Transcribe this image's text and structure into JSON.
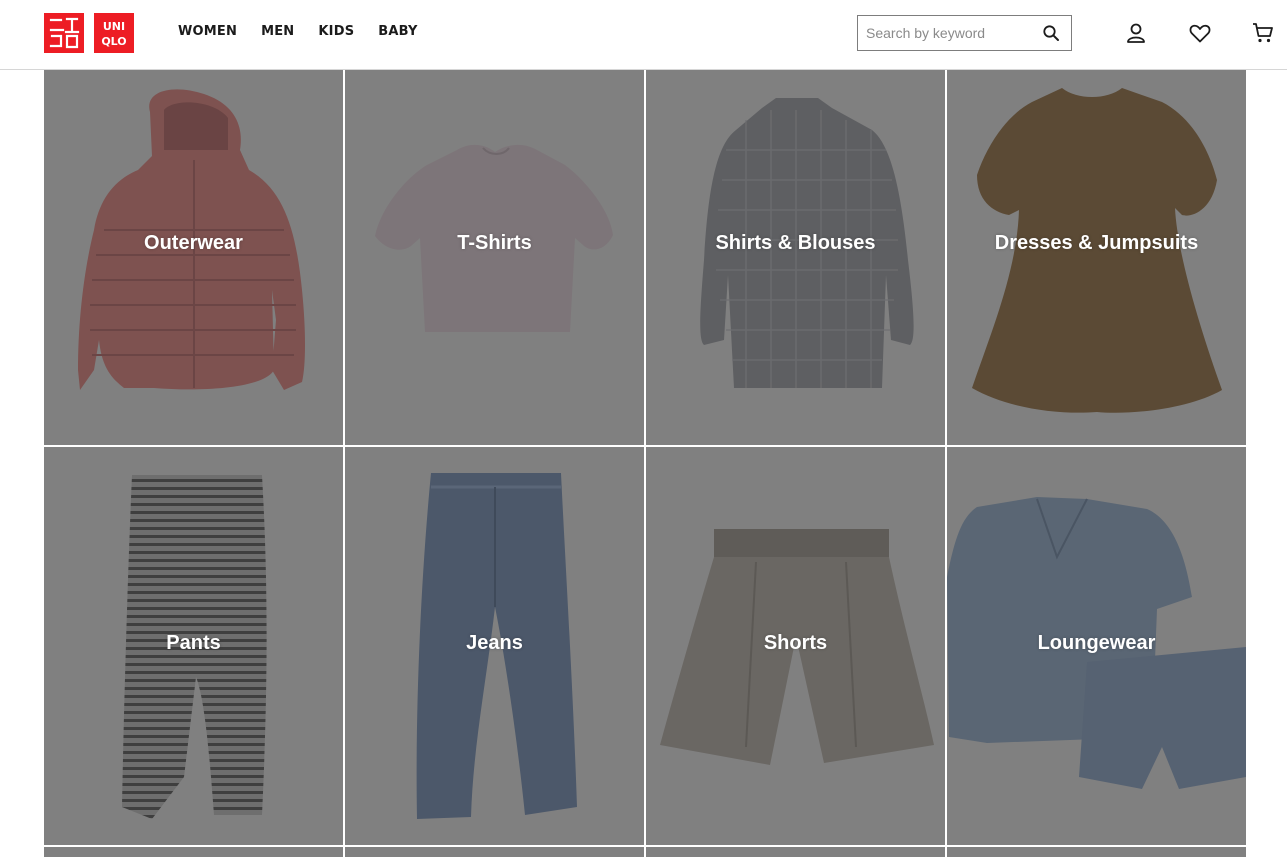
{
  "brand": {
    "name": "UNIQLO",
    "color": "#ed1d24",
    "logo_lines_1": [
      "ユニ",
      "クロ"
    ],
    "logo_lines_2": [
      "UNI",
      "QLO"
    ]
  },
  "nav": {
    "items": [
      "WOMEN",
      "MEN",
      "KIDS",
      "BABY"
    ]
  },
  "search": {
    "placeholder": "Search by keyword",
    "value": "",
    "icon": "search-icon"
  },
  "header_icons": [
    "account-icon",
    "heart-icon",
    "cart-icon"
  ],
  "categories": [
    {
      "label": "Outerwear",
      "image": "red-puffer-jacket"
    },
    {
      "label": "T-Shirts",
      "image": "mauve-puff-sleeve-top"
    },
    {
      "label": "Shirts & Blouses",
      "image": "grey-plaid-shirt"
    },
    {
      "label": "Dresses & Jumpsuits",
      "image": "brown-dress"
    },
    {
      "label": "Pants",
      "image": "striped-pants"
    },
    {
      "label": "Jeans",
      "image": "blue-jeans"
    },
    {
      "label": "Shorts",
      "image": "grey-shorts"
    },
    {
      "label": "Loungewear",
      "image": "blue-floral-pajama-set"
    }
  ],
  "colors": {
    "tile_overlay": "#808080",
    "label_text": "#ffffff",
    "nav_text": "#1b1b1b"
  }
}
